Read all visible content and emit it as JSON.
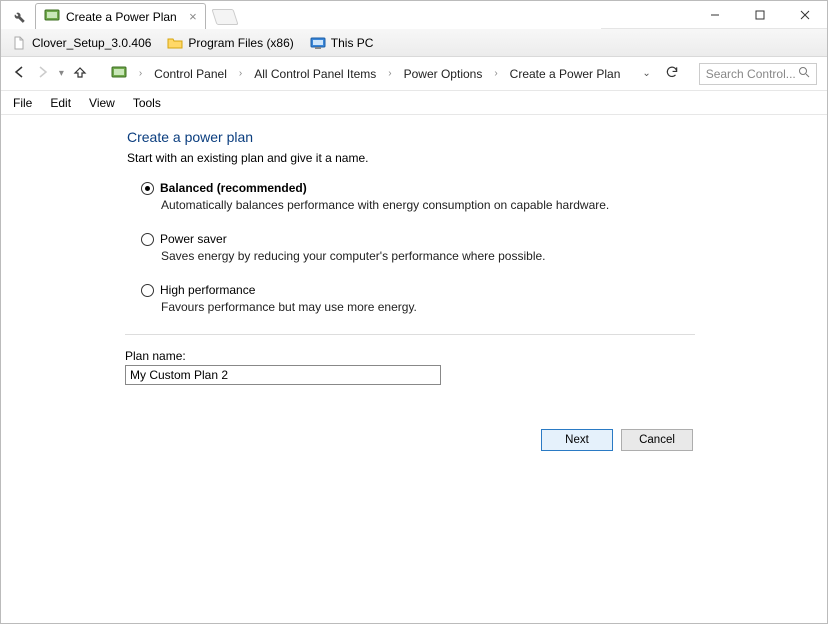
{
  "window": {
    "tab_title": "Create a Power Plan"
  },
  "bookmarks": [
    {
      "label": "Clover_Setup_3.0.406"
    },
    {
      "label": "Program Files (x86)"
    },
    {
      "label": "This PC"
    }
  ],
  "breadcrumb": {
    "items": [
      "Control Panel",
      "All Control Panel Items",
      "Power Options",
      "Create a Power Plan"
    ]
  },
  "search": {
    "placeholder": "Search Control..."
  },
  "menu": {
    "file": "File",
    "edit": "Edit",
    "view": "View",
    "tools": "Tools"
  },
  "page": {
    "heading": "Create a power plan",
    "subtitle": "Start with an existing plan and give it a name."
  },
  "options": [
    {
      "title": "Balanced (recommended)",
      "desc": "Automatically balances performance with energy consumption on capable hardware.",
      "checked": true
    },
    {
      "title": "Power saver",
      "desc": "Saves energy by reducing your computer's performance where possible.",
      "checked": false
    },
    {
      "title": "High performance",
      "desc": "Favours performance but may use more energy.",
      "checked": false
    }
  ],
  "plan": {
    "label": "Plan name:",
    "value": "My Custom Plan 2"
  },
  "buttons": {
    "next": "Next",
    "cancel": "Cancel"
  }
}
